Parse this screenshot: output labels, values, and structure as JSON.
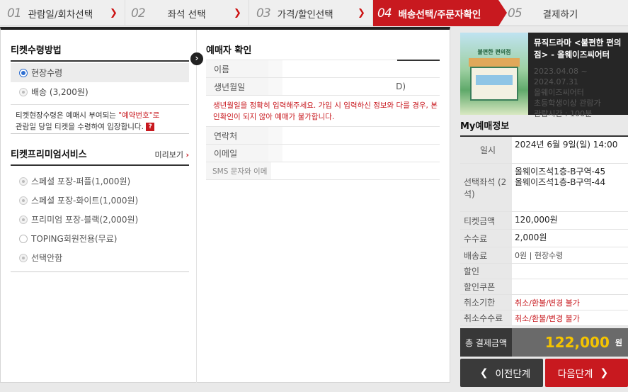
{
  "steps": [
    {
      "num": "01",
      "label": "관람일/회차선택"
    },
    {
      "num": "02",
      "label": "좌석 선택"
    },
    {
      "num": "03",
      "label": "가격/할인선택"
    },
    {
      "num": "04",
      "label": "배송선택/주문자확인"
    },
    {
      "num": "05",
      "label": "결제하기"
    }
  ],
  "receive": {
    "title": "티켓수령방법",
    "options": [
      "현장수령",
      "배송 (3,200원)"
    ],
    "note_pre": "티켓현장수령은 예매시 부여되는 ",
    "note_red": "\"예약번호\"로",
    "note_post": "관람일 당일 티켓을 수령하여 입장합니다.",
    "help_badge": "?"
  },
  "premium": {
    "title": "티켓프리미엄서비스",
    "preview": "미리보기",
    "options": [
      "스페셜 포장-퍼플(1,000원)",
      "스페셜 포장-화이트(1,000원)",
      "프리미엄 포장-블랙(2,000원)",
      "TOPING회원전용(무료)",
      "선택안함"
    ]
  },
  "buyer": {
    "title": "예매자 확인",
    "name_label": "이름",
    "birth_label": "생년월일",
    "birth_suffix": "D)",
    "error": "생년월일을 정확히 입력해주세요. 가입 시 입력하신 정보와 다를 경우, 본인확인이 되지 않아 예매가 불가합니다.",
    "phone_label": "연락처",
    "email_label": "이메일",
    "sms_label": "SMS 문자와 이메"
  },
  "show": {
    "title": "뮤직드라마 <불편한 편의점> - 올웨이즈씨어터",
    "period": "2023.04.08 ~ 2024.07.31",
    "venue": "올웨이즈씨어터",
    "age": "초등학생이상 관람가",
    "runtime": "관람시간 : 100분",
    "poster_text": "불편한 편의점"
  },
  "my": {
    "title": "My예매정보",
    "date_label": "일시",
    "date_value": "2024년 6월 9일(일) 14:00",
    "seat_label": "선택좌석 (2석)",
    "seat1": "올웨이즈석1층-B구역-45",
    "seat2": "올웨이즈석1층-B구역-44",
    "price_label": "티켓금액",
    "price_value": "120,000원",
    "fee_label": "수수료",
    "fee_value": "2,000원",
    "ship_label": "배송료",
    "ship_value": "0원 | 현장수령",
    "discount_label": "할인",
    "coupon_label": "할인쿠폰",
    "cancel_deadline_label": "취소기한",
    "cancel_deadline_value": "취소/환불/변경 불가",
    "cancel_fee_label": "취소수수료",
    "cancel_fee_value": "취소/환불/변경 불가",
    "total_label": "총 결제금액",
    "total_value": "122,000",
    "total_unit": "원"
  },
  "buttons": {
    "prev": "이전단계",
    "next": "다음단계"
  }
}
